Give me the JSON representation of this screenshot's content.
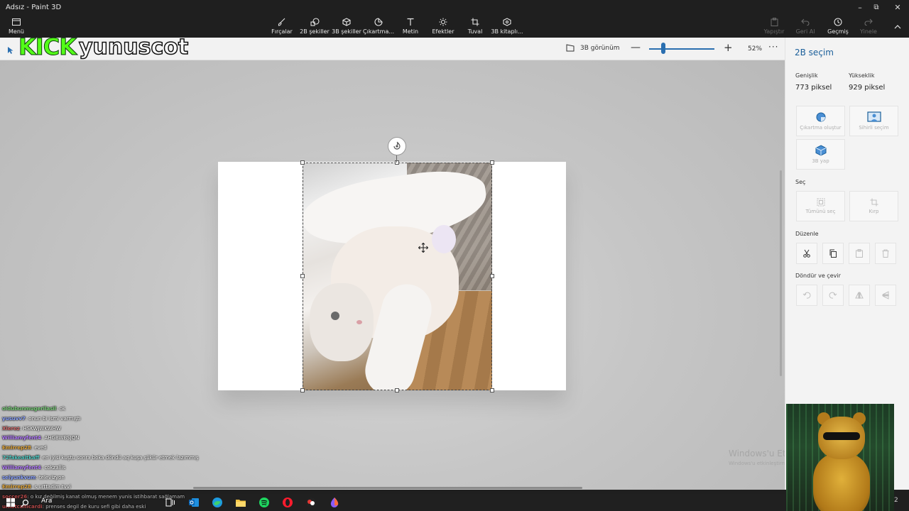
{
  "window": {
    "title": "Adsız - Paint 3D",
    "minimize": "–",
    "restore": "⧉",
    "close": "✕"
  },
  "toolbar": {
    "menu": "Menü",
    "tools": [
      {
        "label": "Fırçalar",
        "icon": "brush-icon"
      },
      {
        "label": "2B şekiller",
        "icon": "2d-shapes-icon"
      },
      {
        "label": "3B şekiller",
        "icon": "3d-shapes-icon"
      },
      {
        "label": "Çıkartma...",
        "icon": "sticker-icon"
      },
      {
        "label": "Metin",
        "icon": "text-icon"
      },
      {
        "label": "Efektler",
        "icon": "effects-icon"
      },
      {
        "label": "Tuval",
        "icon": "canvas-icon"
      },
      {
        "label": "3B kitaplı...",
        "icon": "3d-library-icon"
      }
    ],
    "right": [
      {
        "label": "Yapıştır",
        "enabled": false
      },
      {
        "label": "Geri Al",
        "enabled": false
      },
      {
        "label": "Geçmiş",
        "enabled": true
      },
      {
        "label": "Yinele",
        "enabled": false
      }
    ]
  },
  "subbar": {
    "view3d": "3B görünüm",
    "zoom_minus": "—",
    "zoom_plus": "+",
    "zoom_value": "52%",
    "zoom_level_fraction": 0.22,
    "more": "···"
  },
  "panel": {
    "title": "2B seçim",
    "width_label": "Genişlik",
    "width_value": "773 piksel",
    "height_label": "Yükseklik",
    "height_value": "929 piksel",
    "actions": [
      {
        "label": "Çıkartma oluştur",
        "icon": "sticker-create-icon"
      },
      {
        "label": "Sihirli seçim",
        "icon": "magic-select-icon"
      },
      {
        "label": "3B yap",
        "icon": "make-3d-icon"
      }
    ],
    "select_heading": "Seç",
    "select_actions": [
      {
        "label": "Tümünü seç"
      },
      {
        "label": "Kırp"
      }
    ],
    "edit_heading": "Düzenle",
    "rotate_heading": "Döndür ve çevir"
  },
  "overlay": {
    "kick": "KICK",
    "channel": "yunuscot"
  },
  "watermark": {
    "line1": "Windows'u Etk",
    "line2": "Windows'u etkinleştirmek için Ayarlar'a gidin."
  },
  "chat": [
    {
      "user": "oldubunmugerilasil",
      "text": "ok",
      "color": "#7cd47c"
    },
    {
      "user": "yusuvv7",
      "text": "onun bi ismi varmıştı",
      "color": "#8aa2ff"
    },
    {
      "user": "Xlerez",
      "text": "HSKWJWKWHW",
      "color": "#d26b6b"
    },
    {
      "user": "Williamyfent4",
      "text": "AHGBWBSJQN",
      "color": "#b57cff"
    },
    {
      "user": "Emirrep28",
      "text": "eved",
      "color": "#e5a83a"
    },
    {
      "user": "72fakealtkaff",
      "text": "en iyisi kuştu sonra boka döndü aq kuşa şükür etmek lazımmış",
      "color": "#4fc7c0"
    },
    {
      "user": "Williamyfent4",
      "text": "cokzallis",
      "color": "#b57cff"
    },
    {
      "user": "selyunkvum",
      "text": "televizyon",
      "color": "#8aa2ff"
    },
    {
      "user": "Emirrep28",
      "text": "s urttadim tvvi",
      "color": "#e5a83a"
    },
    {
      "user": "soccer26",
      "text": "o kız değilmiş kanat olmuş menem yunis istihbarat sağlamam",
      "color": "#ff5a5a"
    },
    {
      "user": "umutcanicardi",
      "text": "prenses degil de kuru sefi gibi daha eski",
      "color": "#ff5a5a"
    }
  ],
  "taskbar": {
    "search": "Ara",
    "badge": "2",
    "icons": [
      "task-view-icon",
      "outlook-icon",
      "edge-icon",
      "file-explorer-icon",
      "spotify-icon",
      "opera-icon",
      "app-icon",
      "paint3d-icon"
    ]
  },
  "colors": {
    "accent": "#1b5f9a",
    "kick_green": "#53fc18"
  }
}
